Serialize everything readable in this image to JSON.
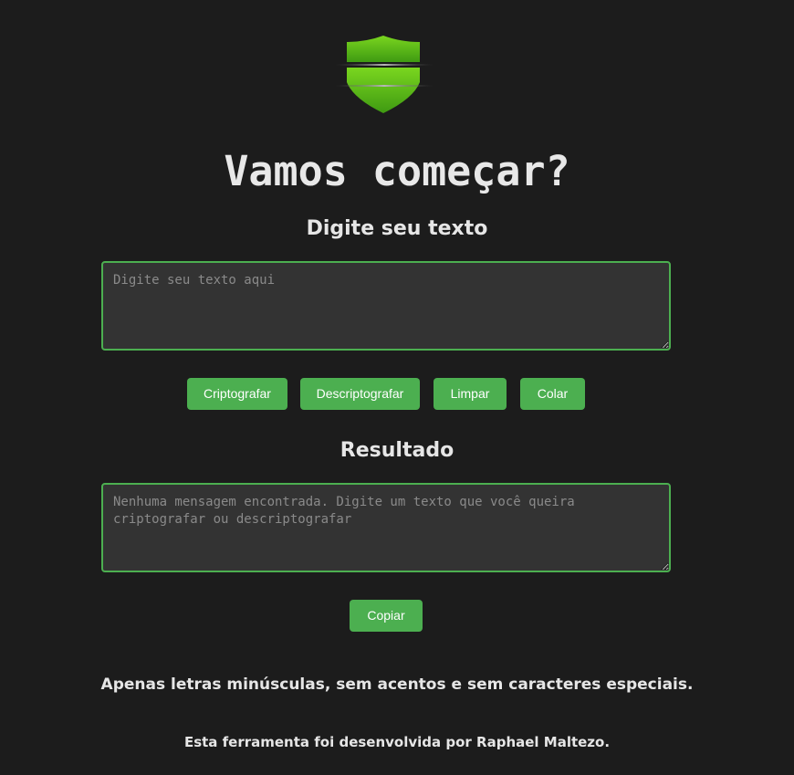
{
  "logo": {
    "icon": "shield-icon",
    "color": "#5cc21a"
  },
  "title": "Vamos começar?",
  "input_section": {
    "heading": "Digite seu texto",
    "placeholder": "Digite seu texto aqui",
    "value": ""
  },
  "actions": {
    "encrypt_label": "Criptografar",
    "decrypt_label": "Descriptografar",
    "clear_label": "Limpar",
    "paste_label": "Colar"
  },
  "result_section": {
    "heading": "Resultado",
    "placeholder": "Nenhuma mensagem encontrada. Digite um texto que você queira criptografar ou descriptografar",
    "value": "",
    "copy_label": "Copiar"
  },
  "rule_note": "Apenas letras minúsculas, sem acentos e sem caracteres especiais.",
  "credit": "Esta ferramenta foi desenvolvida por Raphael Maltezo.",
  "colors": {
    "background": "#1c1c1c",
    "accent": "#4caf50",
    "field": "#333333",
    "text": "#e6e6e6"
  }
}
